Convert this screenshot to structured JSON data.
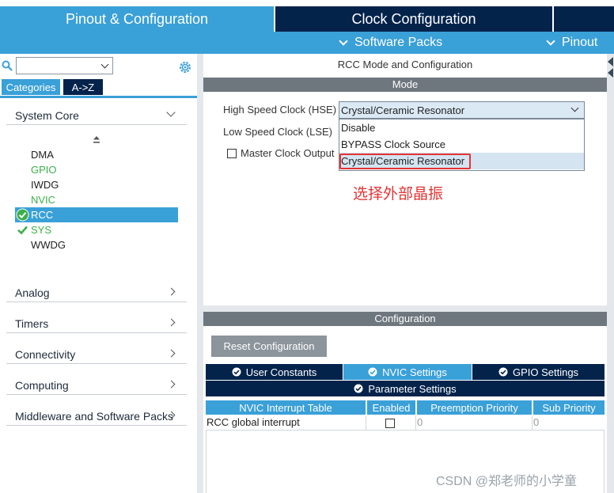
{
  "top_tabs": {
    "pinout": "Pinout & Configuration",
    "clock": "Clock Configuration"
  },
  "sub_bar": {
    "software_packs": "Software Packs",
    "pinout": "Pinout"
  },
  "left": {
    "search": {
      "value": ""
    },
    "tabs": {
      "categories": "Categories",
      "az": "A->Z"
    },
    "sections": {
      "system_core": "System Core",
      "analog": "Analog",
      "timers": "Timers",
      "connectivity": "Connectivity",
      "computing": "Computing",
      "middleware": "Middleware and Software Packs"
    },
    "core_items": [
      {
        "label": "DMA",
        "state": "normal"
      },
      {
        "label": "GPIO",
        "state": "green"
      },
      {
        "label": "IWDG",
        "state": "normal"
      },
      {
        "label": "NVIC",
        "state": "green"
      },
      {
        "label": "RCC",
        "state": "selected-ok"
      },
      {
        "label": "SYS",
        "state": "green-ok"
      },
      {
        "label": "WWDG",
        "state": "normal"
      }
    ]
  },
  "right": {
    "title": "RCC Mode and Configuration",
    "mode_header": "Mode",
    "hse_label": "High Speed Clock (HSE)",
    "hse_value": "Crystal/Ceramic Resonator",
    "lse_label": "Low Speed Clock (LSE)",
    "mco_label": "Master Clock Output",
    "dropdown_options": [
      "Disable",
      "BYPASS Clock Source",
      "Crystal/Ceramic Resonator"
    ],
    "annotation": "选择外部晶振",
    "config_header": "Configuration",
    "reset_button": "Reset Configuration",
    "config_tabs": {
      "user_constants": "User Constants",
      "nvic_settings": "NVIC Settings",
      "gpio_settings": "GPIO Settings",
      "parameter_settings": "Parameter Settings"
    },
    "table": {
      "headers": [
        "NVIC Interrupt Table",
        "Enabled",
        "Preemption Priority",
        "Sub Priority"
      ],
      "row": {
        "name": "RCC global interrupt",
        "enabled": false,
        "preemption": "0",
        "sub": "0"
      }
    }
  },
  "watermark": "CSDN @郑老师的小学童",
  "colors": {
    "accent": "#3aa0d8",
    "dark_navy": "#03234b",
    "header_gray": "#6e767e",
    "highlight_red": "#e33434",
    "status_green": "#3bb04a"
  }
}
